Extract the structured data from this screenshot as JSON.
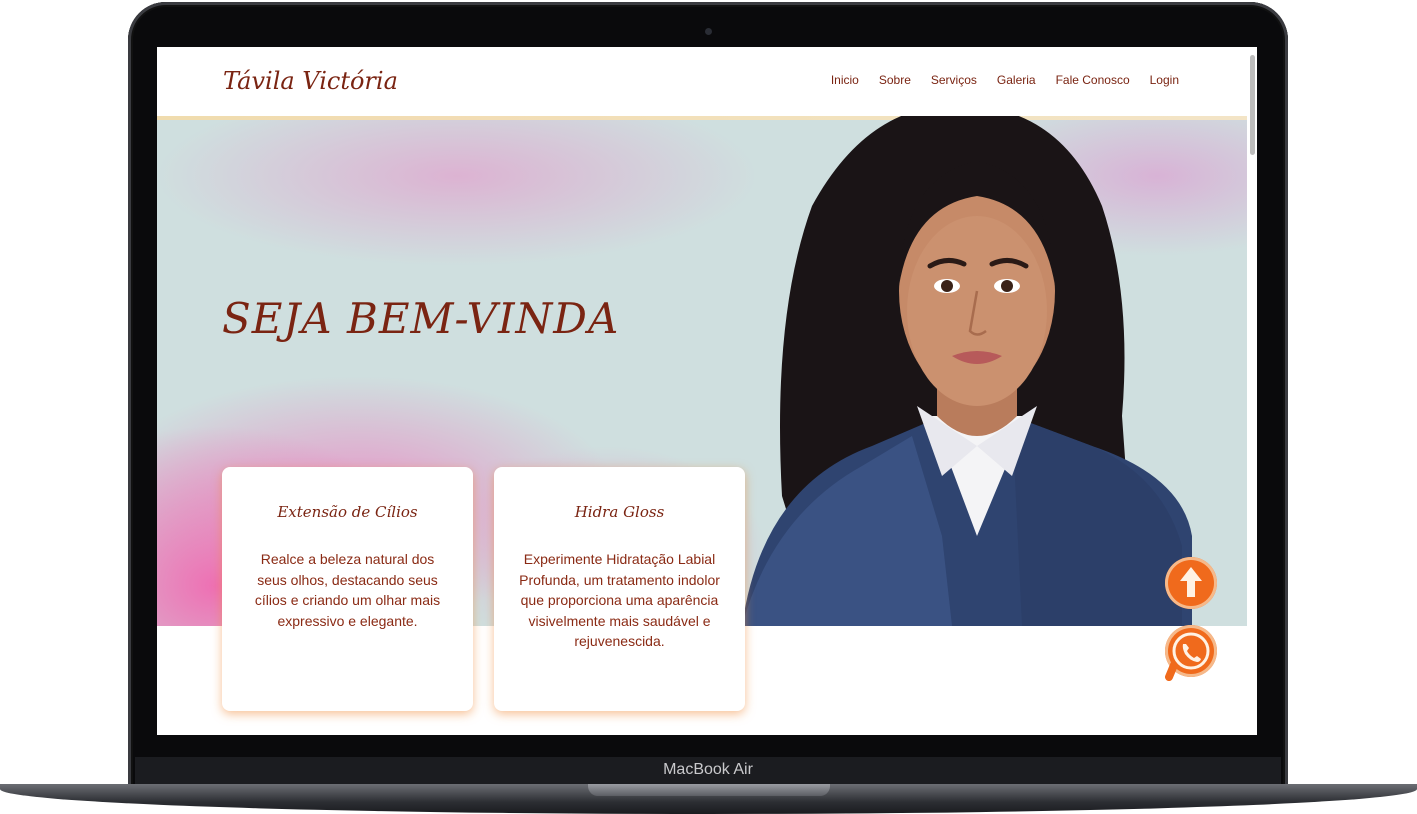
{
  "device": {
    "label": "MacBook Air"
  },
  "header": {
    "logo": "Távila Victória",
    "nav": [
      "Inicio",
      "Sobre",
      "Serviços",
      "Galeria",
      "Fale Conosco",
      "Login"
    ]
  },
  "hero": {
    "title": "SEJA BEM-VINDA"
  },
  "cards": [
    {
      "title": "Extensão de Cílios",
      "text": "Realce a beleza natural dos seus olhos, destacando seus cílios e criando um olhar mais expressivo e elegante."
    },
    {
      "title": "Hidra Gloss",
      "text": "Experimente Hidratação Labial Profunda, um tratamento indolor que proporciona uma aparência visivelmente mais saudável e rejuvenescida."
    }
  ],
  "floating": {
    "scroll_top_icon": "arrow-up-icon",
    "whatsapp_icon": "whatsapp-icon"
  },
  "colors": {
    "brand": "#7a2412",
    "accent": "#f06a1c"
  }
}
